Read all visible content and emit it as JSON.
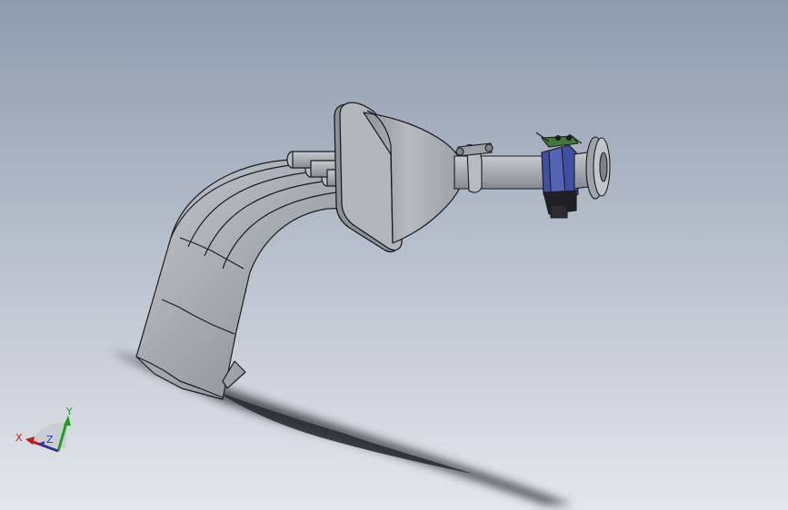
{
  "viewport": {
    "background_top": "#8f9bae",
    "background_bottom": "#e3e6ec",
    "model_color": "#a2a6ad",
    "model_edge": "#1c1c1c",
    "valve_color": "#3f4fa2",
    "accent_green": "#3f7a3a"
  },
  "triad": {
    "x_label": "X",
    "y_label": "Y",
    "z_label": "Z",
    "x_color": "#c21a1a",
    "y_color": "#18a418",
    "z_color": "#1a3aa8"
  }
}
